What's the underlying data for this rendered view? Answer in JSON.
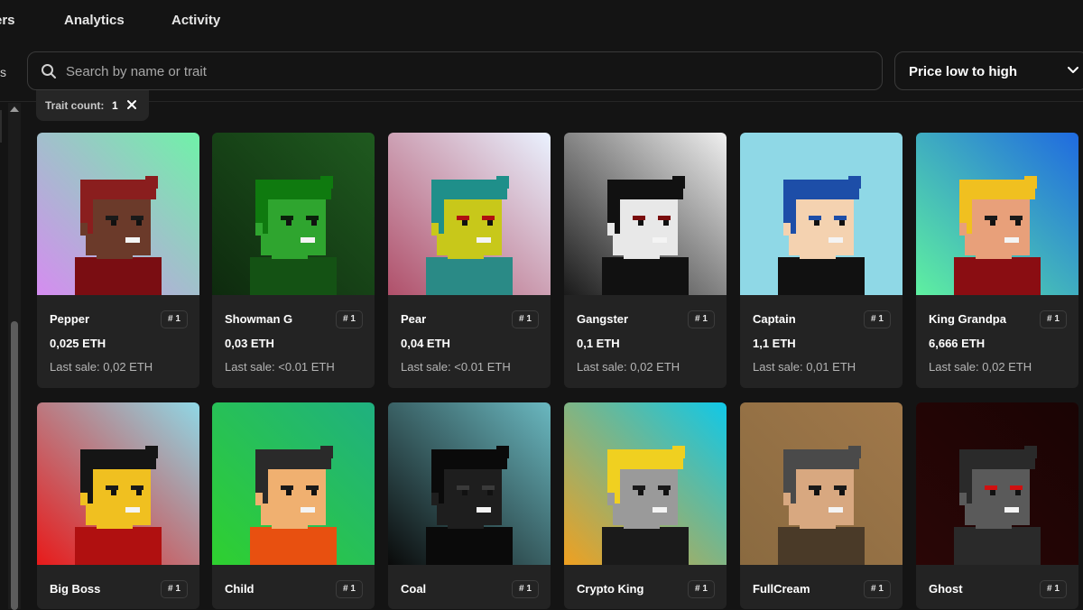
{
  "nav": {
    "tabs": [
      "ers",
      "Analytics",
      "Activity"
    ],
    "left_fragment": "s"
  },
  "search": {
    "placeholder": "Search by name or trait",
    "value": ""
  },
  "sort": {
    "label": "Price low to high"
  },
  "filter_chip": {
    "label": "Trait count:",
    "value": "1"
  },
  "cards": [
    {
      "name": "Pepper",
      "rank": "# 1",
      "price": "0,025 ETH",
      "last_sale": "Last sale: 0,02 ETH",
      "bg": [
        "#d58cf0",
        "#6ff2a8"
      ],
      "skin": "#6b3a2a",
      "hair": "#8a1e1e",
      "shirt": "#7a0d12",
      "eyes": "#1a1a1a",
      "icon": "pixel-avatar-icon"
    },
    {
      "name": "Showman G",
      "rank": "# 1",
      "price": "0,03 ETH",
      "last_sale": "Last sale: <0.01 ETH",
      "bg": [
        "#0e2a0e",
        "#1f5a1f"
      ],
      "skin": "#2fa52f",
      "hair": "#0f7a0f",
      "shirt": "#145214",
      "eyes": "#0a200a",
      "icon": "pixel-avatar-icon"
    },
    {
      "name": "Pear",
      "rank": "# 1",
      "price": "0,04 ETH",
      "last_sale": "Last sale: <0.01 ETH",
      "bg": [
        "#b0506a",
        "#eaf2ff"
      ],
      "skin": "#c8c81a",
      "hair": "#1f8f8a",
      "shirt": "#2a8a86",
      "eyes": "#b01010",
      "icon": "pixel-avatar-icon"
    },
    {
      "name": "Gangster",
      "rank": "# 1",
      "price": "0,1 ETH",
      "last_sale": "Last sale: 0,02 ETH",
      "bg": [
        "#1a1a1a",
        "#f0f0f0"
      ],
      "skin": "#e8e8e8",
      "hair": "#111111",
      "shirt": "#111111",
      "eyes": "#7a0d0d",
      "icon": "pixel-avatar-icon"
    },
    {
      "name": "Captain",
      "rank": "# 1",
      "price": "1,1 ETH",
      "last_sale": "Last sale: 0,01 ETH",
      "bg": [
        "#8fd8e6",
        "#8fd8e6"
      ],
      "skin": "#f4d2b0",
      "hair": "#1d4ea8",
      "shirt": "#111111",
      "eyes": "#1d4ea8",
      "icon": "pixel-avatar-icon"
    },
    {
      "name": "King Grandpa",
      "rank": "# 1",
      "price": "6,666 ETH",
      "last_sale": "Last sale: 0,02 ETH",
      "bg": [
        "#5ff0a0",
        "#1f6ae0"
      ],
      "skin": "#e8a07a",
      "hair": "#f0c020",
      "shirt": "#8a0d12",
      "eyes": "#1a1a1a",
      "icon": "pixel-avatar-icon"
    },
    {
      "name": "Big Boss",
      "rank": "# 1",
      "price": "",
      "last_sale": "",
      "bg": [
        "#e81a1a",
        "#8fd8e6"
      ],
      "skin": "#f0c020",
      "hair": "#151515",
      "shirt": "#b01010",
      "eyes": "#1a1a1a",
      "icon": "pixel-avatar-icon"
    },
    {
      "name": "Child",
      "rank": "# 1",
      "price": "",
      "last_sale": "",
      "bg": [
        "#2fd02f",
        "#1fb080"
      ],
      "skin": "#f0b070",
      "hair": "#2a2a2a",
      "shirt": "#e85010",
      "eyes": "#1a1a1a",
      "icon": "pixel-avatar-icon"
    },
    {
      "name": "Coal",
      "rank": "# 1",
      "price": "",
      "last_sale": "",
      "bg": [
        "#0a0a0a",
        "#6ab8c0"
      ],
      "skin": "#1e1e1e",
      "hair": "#0a0a0a",
      "shirt": "#0a0a0a",
      "eyes": "#3a3a3a",
      "icon": "pixel-avatar-icon"
    },
    {
      "name": "Crypto King",
      "rank": "# 1",
      "price": "",
      "last_sale": "",
      "bg": [
        "#f0a020",
        "#10c8e8"
      ],
      "skin": "#9a9a9a",
      "hair": "#f0d020",
      "shirt": "#1a1a1a",
      "eyes": "#1a1a1a",
      "icon": "pixel-avatar-icon"
    },
    {
      "name": "FullCream",
      "rank": "# 1",
      "price": "",
      "last_sale": "",
      "bg": [
        "#8a6a40",
        "#a0784a"
      ],
      "skin": "#d8a880",
      "hair": "#4a4a4a",
      "shirt": "#4a3a28",
      "eyes": "#1a1a1a",
      "icon": "pixel-avatar-icon"
    },
    {
      "name": "Ghost",
      "rank": "# 1",
      "price": "",
      "last_sale": "",
      "bg": [
        "#2a0606",
        "#1a0404"
      ],
      "skin": "#5a5a5a",
      "hair": "#2a2a2a",
      "shirt": "#2a2a2a",
      "eyes": "#d01010",
      "icon": "pixel-avatar-icon"
    }
  ]
}
